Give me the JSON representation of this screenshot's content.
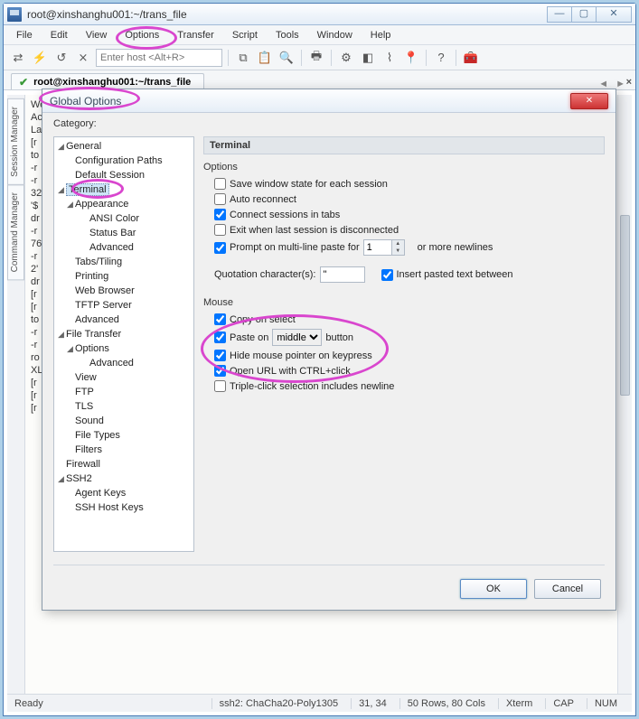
{
  "window": {
    "title": "root@xinshanghu001:~/trans_file"
  },
  "menu": {
    "file": "File",
    "edit": "Edit",
    "view": "View",
    "options": "Options",
    "transfer": "Transfer",
    "script": "Script",
    "tools": "Tools",
    "window": "Window",
    "help": "Help"
  },
  "toolbar": {
    "host_placeholder": "Enter host <Alt+R>"
  },
  "tab": {
    "label": "root@xinshanghu001:~/trans_file",
    "close": "×"
  },
  "side": {
    "session": "Session Manager",
    "command": "Command Manager"
  },
  "term_lines": [
    "We",
    "",
    "Ac",
    "",
    "La",
    "[r",
    "to",
    "-r",
    "-r",
    "32",
    "'$",
    "dr",
    "-r",
    "76",
    "-r",
    "2'",
    "dr",
    "[r",
    "[r",
    "to",
    "-r",
    "-r",
    "ro",
    "XL",
    "[r",
    "[r",
    "[r"
  ],
  "dialog": {
    "title": "Global Options",
    "category_label": "Category:",
    "section": "Terminal",
    "options_label": "Options",
    "opts": {
      "save_state": "Save window state for each session",
      "auto_reconnect": "Auto reconnect",
      "connect_tabs": "Connect sessions in tabs",
      "exit_last": "Exit when last session is disconnected",
      "prompt_paste_pre": "Prompt on multi-line paste for",
      "prompt_paste_val": "1",
      "prompt_paste_post": "or more newlines",
      "quot_label": "Quotation character(s):",
      "quot_val": "\"",
      "insert_between": "Insert pasted text between"
    },
    "mouse_label": "Mouse",
    "mouse": {
      "copy_select": "Copy on select",
      "paste_on_pre": "Paste on",
      "paste_on_sel": "middle",
      "paste_on_post": "button",
      "hide_pointer": "Hide mouse pointer on keypress",
      "open_url": "Open URL with CTRL+click",
      "triple_click": "Triple-click selection includes newline"
    },
    "tree": [
      {
        "l": "General",
        "d": 0,
        "exp": true
      },
      {
        "l": "Configuration Paths",
        "d": 1
      },
      {
        "l": "Default Session",
        "d": 1
      },
      {
        "l": "Terminal",
        "d": 0,
        "exp": true,
        "sel": true
      },
      {
        "l": "Appearance",
        "d": 1,
        "exp": true
      },
      {
        "l": "ANSI Color",
        "d": 2
      },
      {
        "l": "Status Bar",
        "d": 2
      },
      {
        "l": "Advanced",
        "d": 2
      },
      {
        "l": "Tabs/Tiling",
        "d": 1
      },
      {
        "l": "Printing",
        "d": 1
      },
      {
        "l": "Web Browser",
        "d": 1
      },
      {
        "l": "TFTP Server",
        "d": 1
      },
      {
        "l": "Advanced",
        "d": 1
      },
      {
        "l": "File Transfer",
        "d": 0,
        "exp": true
      },
      {
        "l": "Options",
        "d": 1,
        "exp": true
      },
      {
        "l": "Advanced",
        "d": 2
      },
      {
        "l": "View",
        "d": 1
      },
      {
        "l": "FTP",
        "d": 1
      },
      {
        "l": "TLS",
        "d": 1
      },
      {
        "l": "Sound",
        "d": 1
      },
      {
        "l": "File Types",
        "d": 1
      },
      {
        "l": "Filters",
        "d": 1
      },
      {
        "l": "Firewall",
        "d": 0
      },
      {
        "l": "SSH2",
        "d": 0,
        "exp": true
      },
      {
        "l": "Agent Keys",
        "d": 1
      },
      {
        "l": "SSH Host Keys",
        "d": 1
      }
    ],
    "buttons": {
      "ok": "OK",
      "cancel": "Cancel"
    }
  },
  "status": {
    "ready": "Ready",
    "cipher": "ssh2: ChaCha20-Poly1305",
    "pos": "31,  34",
    "size": "50 Rows, 80 Cols",
    "term": "Xterm",
    "cap": "CAP",
    "num": "NUM"
  }
}
